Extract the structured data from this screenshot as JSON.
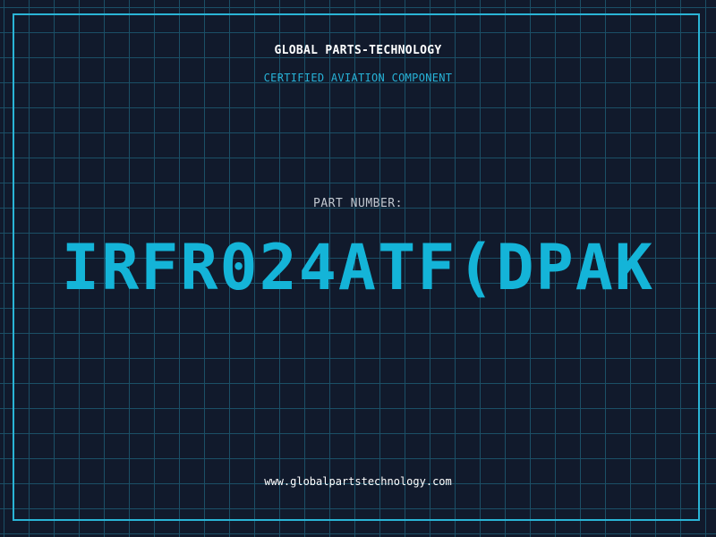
{
  "header": {
    "company": "GLOBAL PARTS-TECHNOLOGY",
    "tagline": "CERTIFIED AVIATION COMPONENT"
  },
  "part": {
    "label": "PART NUMBER:",
    "number": "IRFR024ATF(DPAK"
  },
  "footer": {
    "website": "www.globalpartstechnology.com"
  },
  "colors": {
    "background": "#111a2c",
    "grid": "#1b4f66",
    "accent": "#14b4d8",
    "frame": "#2ab4d6"
  }
}
